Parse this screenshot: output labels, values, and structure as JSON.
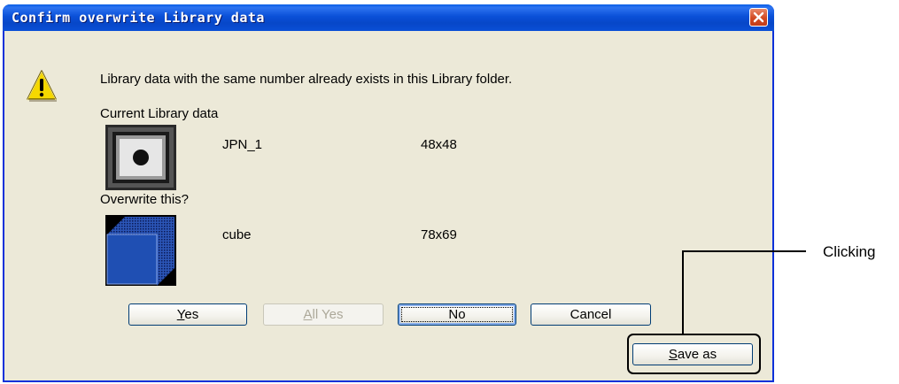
{
  "dialog": {
    "title": "Confirm overwrite Library data",
    "message": "Library data with the same number already exists in this Library folder.",
    "current_label": "Current Library data",
    "current": {
      "name": "JPN_1",
      "size": "48x48"
    },
    "overwrite_label": "Overwrite this?",
    "overwrite": {
      "name": "cube",
      "size": "78x69"
    }
  },
  "buttons": {
    "yes": {
      "prefix": "",
      "mnemonic": "Y",
      "rest": "es"
    },
    "all_yes": {
      "prefix": "",
      "mnemonic": "A",
      "rest": "ll Yes"
    },
    "no": "No",
    "cancel": "Cancel",
    "save_as": {
      "prefix": "",
      "mnemonic": "S",
      "rest": "ave as"
    }
  },
  "annotation": {
    "label": "Clicking"
  },
  "colors": {
    "title_bar": "#0a50d8",
    "dialog_bg": "#ece9d8",
    "close_button": "#d24a22",
    "cube_face": "#1f4fb3"
  }
}
